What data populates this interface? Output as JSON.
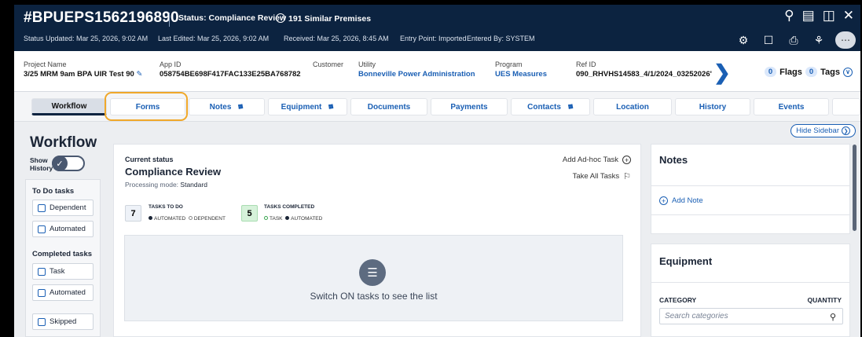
{
  "header": {
    "title": "#BPUEPS1562196890",
    "status": "Status: Compliance Review",
    "similar": "191 Similar Premises",
    "meta": [
      "Status Updated: Mar 25, 2026, 9:02 AM",
      "Last Edited: Mar 25, 2026, 9:02 AM",
      "Received: Mar 25, 2026, 8:45 AM",
      "Entry Point: Imported",
      "Entered By: SYSTEM"
    ],
    "top_icons": [
      "search-icon",
      "layout-icon",
      "panel-icon",
      "close-icon"
    ],
    "action_icons": [
      "settings-icon",
      "bookmark-icon",
      "print-icon",
      "hierarchy-icon",
      "more-icon"
    ]
  },
  "info": {
    "project_name_label": "Project Name",
    "project_name": "3/25 MRM 9am BPA UIR Test 90",
    "app_id_label": "App ID",
    "app_id": "058754BE698F417FAC133E25BA768782",
    "customer_label": "Customer",
    "utility_label": "Utility",
    "utility": "Bonneville Power Administration",
    "program_label": "Program",
    "program": "UES Measures",
    "ref_id_label": "Ref ID",
    "ref_id": "090_RHVHS14583_4/1/2024_03252026'",
    "flags_count": "0",
    "flags_label": "Flags",
    "tags_count": "0",
    "tags_label": "Tags"
  },
  "tabs": [
    {
      "label": "Workflow"
    },
    {
      "label": "Forms"
    },
    {
      "label": "Notes"
    },
    {
      "label": "Equipment"
    },
    {
      "label": "Documents"
    },
    {
      "label": "Payments"
    },
    {
      "label": "Contacts"
    },
    {
      "label": "Location"
    },
    {
      "label": "History"
    },
    {
      "label": "Events"
    }
  ],
  "sidebar_toggle": "Hide Sidebar",
  "workflow": {
    "title": "Workflow",
    "show_history_1": "Show",
    "show_history_2": "History",
    "todo_group": "To Do tasks",
    "dependent": "Dependent",
    "automated": "Automated",
    "completed_group": "Completed tasks",
    "task": "Task",
    "automated2": "Automated",
    "skipped": "Skipped"
  },
  "status_panel": {
    "current_status_label": "Current status",
    "current_status": "Compliance Review",
    "processing_mode_label": "Processing mode:",
    "processing_mode": "Standard",
    "add_adhoc": "Add Ad-hoc Task",
    "take_all": "Take All Tasks",
    "todo_count": "7",
    "todo_caption": "TASKS TO DO",
    "todo_legend_a": "AUTOMATED",
    "todo_legend_b": "DEPENDENT",
    "done_count": "5",
    "done_caption": "TASKS COMPLETED",
    "done_legend_a": "TASK",
    "done_legend_b": "AUTOMATED",
    "empty_msg": "Switch ON tasks to see the list"
  },
  "notes_panel": {
    "title": "Notes",
    "add_note": "Add Note"
  },
  "equipment_panel": {
    "title": "Equipment",
    "category_label": "CATEGORY",
    "quantity_label": "QUANTITY",
    "search_placeholder": "Search categories"
  }
}
